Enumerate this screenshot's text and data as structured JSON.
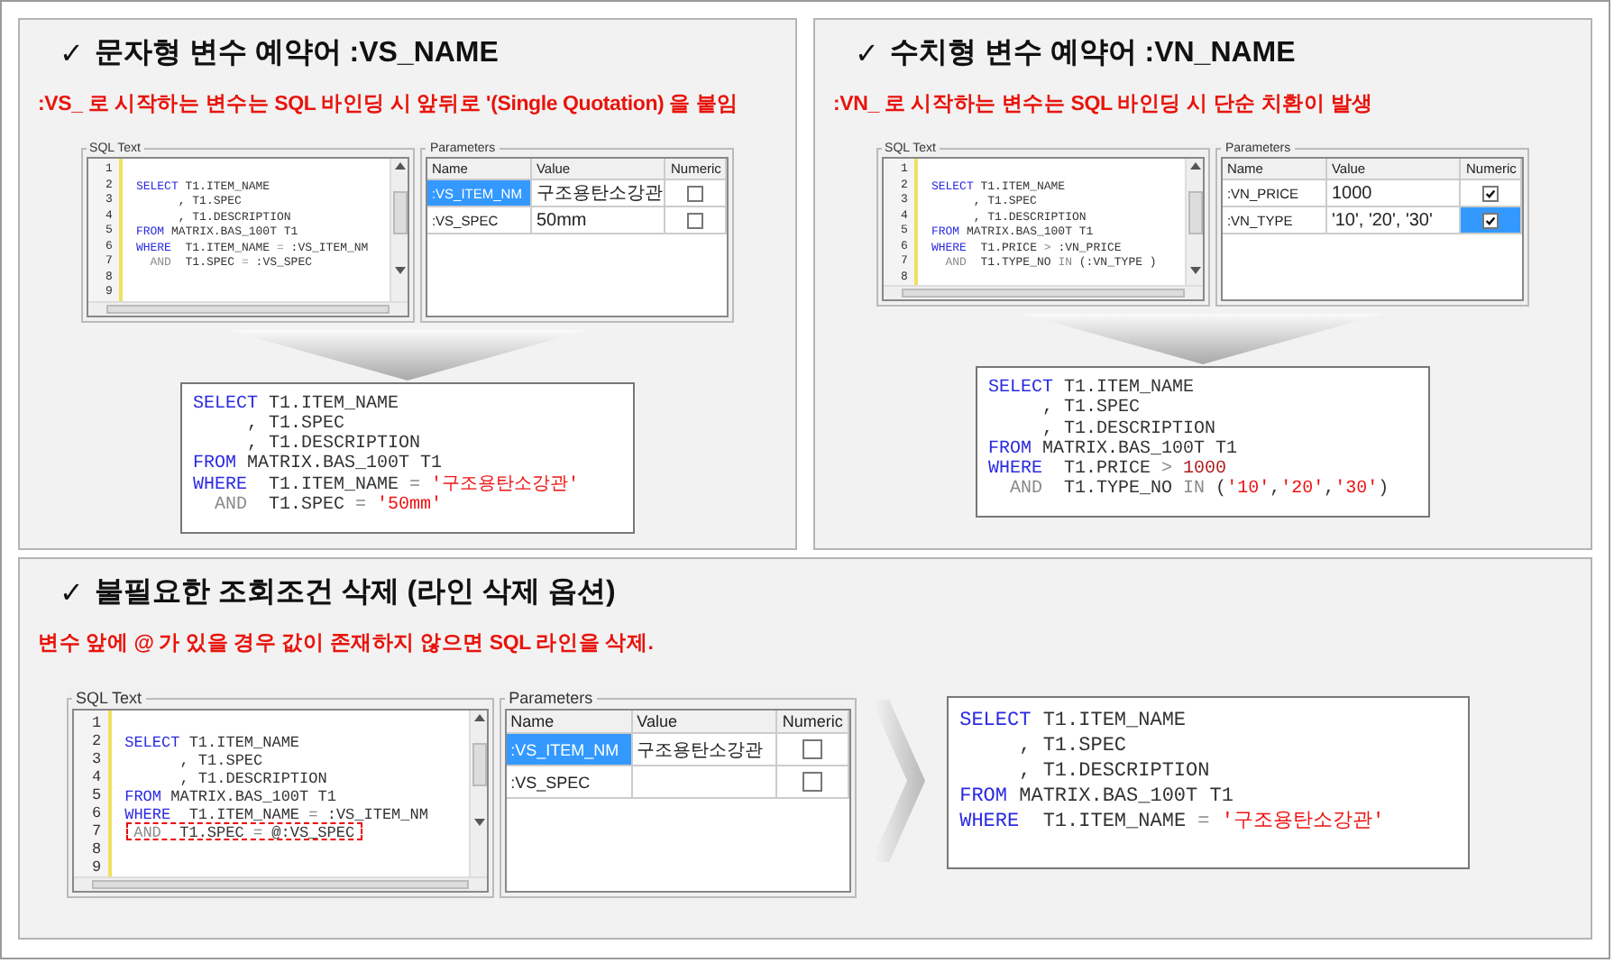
{
  "sections": [
    {
      "check": "✓",
      "title": "문자형 변수 예약어 :VS_NAME",
      "note": ":VS_ 로 시작하는 변수는 SQL 바인딩 시 앞뒤로 '(Single Quotation) 을 붙임",
      "sql_panel": {
        "label": "SQL Text",
        "lines": [
          {
            "no": "1",
            "marked": false
          },
          {
            "no": "2",
            "marked": false,
            "tokens": [
              {
                "t": "SELECT",
                "kind": "keyword"
              },
              {
                "t": " T1.ITEM_NAME",
                "kind": "plain"
              }
            ]
          },
          {
            "no": "3",
            "marked": false,
            "tokens": [
              {
                "t": "      , T1.SPEC",
                "kind": "plain"
              }
            ]
          },
          {
            "no": "4",
            "marked": false,
            "tokens": [
              {
                "t": "      , T1.DESCRIPTION",
                "kind": "plain"
              }
            ]
          },
          {
            "no": "5",
            "marked": false,
            "tokens": [
              {
                "t": "FROM",
                "kind": "keyword"
              },
              {
                "t": " MATRIX.BAS_100T T1",
                "kind": "plain"
              }
            ]
          },
          {
            "no": "6",
            "marked": false,
            "tokens": [
              {
                "t": "WHERE",
                "kind": "keyword"
              },
              {
                "t": "  T1.ITEM_NAME ",
                "kind": "plain"
              },
              {
                "t": "=",
                "kind": "operator"
              },
              {
                "t": " :VS_ITEM_NM",
                "kind": "plain"
              }
            ]
          },
          {
            "no": "7",
            "marked": false,
            "tokens": [
              {
                "t": "  AND",
                "kind": "operator"
              },
              {
                "t": "  T1.SPEC ",
                "kind": "plain"
              },
              {
                "t": "=",
                "kind": "operator"
              },
              {
                "t": " :VS_SPEC",
                "kind": "plain"
              }
            ]
          },
          {
            "no": "8",
            "marked": false
          },
          {
            "no": "9",
            "marked": false
          }
        ]
      },
      "params_panel": {
        "label": "Parameters",
        "columns": [
          "Name",
          "Value",
          "Numeric"
        ],
        "rows": [
          {
            "name": ":VS_ITEM_NM",
            "value": "구조용탄소강관",
            "numeric": false,
            "name_selected": true,
            "numeric_selected": false
          },
          {
            "name": ":VS_SPEC",
            "value": "50mm",
            "numeric": false,
            "name_selected": false,
            "numeric_selected": false
          }
        ]
      },
      "result": {
        "lines": [
          {
            "tokens": [
              {
                "t": "SELECT",
                "kind": "keyword"
              },
              {
                "t": " T1.ITEM_NAME",
                "kind": "plain"
              }
            ]
          },
          {
            "tokens": [
              {
                "t": "     , T1.SPEC",
                "kind": "plain"
              }
            ]
          },
          {
            "tokens": [
              {
                "t": "     , T1.DESCRIPTION",
                "kind": "plain"
              }
            ]
          },
          {
            "tokens": [
              {
                "t": "FROM",
                "kind": "keyword"
              },
              {
                "t": " MATRIX.BAS_100T T1",
                "kind": "plain"
              }
            ]
          },
          {
            "tokens": [
              {
                "t": "WHERE",
                "kind": "keyword"
              },
              {
                "t": "  T1.ITEM_NAME ",
                "kind": "plain"
              },
              {
                "t": "= ",
                "kind": "operator"
              },
              {
                "t": "'구조용탄소강관'",
                "kind": "string"
              }
            ]
          },
          {
            "tokens": [
              {
                "t": "  AND",
                "kind": "operator"
              },
              {
                "t": "  T1.SPEC ",
                "kind": "plain"
              },
              {
                "t": "= ",
                "kind": "operator"
              },
              {
                "t": "'50mm'",
                "kind": "string"
              }
            ]
          }
        ]
      }
    },
    {
      "check": "✓",
      "title": "수치형 변수 예약어 :VN_NAME",
      "note": ":VN_ 로 시작하는 변수는 SQL 바인딩 시 단순 치환이 발생",
      "sql_panel": {
        "label": "SQL Text",
        "lines": [
          {
            "no": "1",
            "marked": false
          },
          {
            "no": "2",
            "marked": false,
            "tokens": [
              {
                "t": "SELECT",
                "kind": "keyword"
              },
              {
                "t": " T1.ITEM_NAME",
                "kind": "plain"
              }
            ]
          },
          {
            "no": "3",
            "marked": false,
            "tokens": [
              {
                "t": "      , T1.SPEC",
                "kind": "plain"
              }
            ]
          },
          {
            "no": "4",
            "marked": false,
            "tokens": [
              {
                "t": "      , T1.DESCRIPTION",
                "kind": "plain"
              }
            ]
          },
          {
            "no": "5",
            "marked": false,
            "tokens": [
              {
                "t": "FROM",
                "kind": "keyword"
              },
              {
                "t": " MATRIX.BAS_100T T1",
                "kind": "plain"
              }
            ]
          },
          {
            "no": "6",
            "marked": false,
            "tokens": [
              {
                "t": "WHERE",
                "kind": "keyword"
              },
              {
                "t": "  T1.PRICE ",
                "kind": "plain"
              },
              {
                "t": ">",
                "kind": "operator"
              },
              {
                "t": " :VN_PRICE",
                "kind": "plain"
              }
            ]
          },
          {
            "no": "7",
            "marked": false,
            "tokens": [
              {
                "t": "  AND",
                "kind": "operator"
              },
              {
                "t": "  T1.TYPE_NO ",
                "kind": "plain"
              },
              {
                "t": "IN",
                "kind": "operator"
              },
              {
                "t": " (:VN_TYPE )",
                "kind": "plain"
              }
            ]
          },
          {
            "no": "8",
            "marked": false
          }
        ]
      },
      "params_panel": {
        "label": "Parameters",
        "columns": [
          "Name",
          "Value",
          "Numeric"
        ],
        "rows": [
          {
            "name": ":VN_PRICE",
            "value": "1000",
            "numeric": true,
            "name_selected": false,
            "numeric_selected": false
          },
          {
            "name": ":VN_TYPE",
            "value": "'10', '20', '30'",
            "numeric": true,
            "name_selected": false,
            "numeric_selected": true
          }
        ]
      },
      "result": {
        "lines": [
          {
            "tokens": [
              {
                "t": "SELECT",
                "kind": "keyword"
              },
              {
                "t": " T1.ITEM_NAME",
                "kind": "plain"
              }
            ]
          },
          {
            "tokens": [
              {
                "t": "     , T1.SPEC",
                "kind": "plain"
              }
            ]
          },
          {
            "tokens": [
              {
                "t": "     , T1.DESCRIPTION",
                "kind": "plain"
              }
            ]
          },
          {
            "tokens": [
              {
                "t": "FROM",
                "kind": "keyword"
              },
              {
                "t": " MATRIX.BAS_100T T1",
                "kind": "plain"
              }
            ]
          },
          {
            "tokens": [
              {
                "t": "WHERE",
                "kind": "keyword"
              },
              {
                "t": "  T1.PRICE ",
                "kind": "plain"
              },
              {
                "t": "> ",
                "kind": "operator"
              },
              {
                "t": "1000",
                "kind": "number"
              }
            ]
          },
          {
            "tokens": [
              {
                "t": "  AND",
                "kind": "operator"
              },
              {
                "t": "  T1.TYPE_NO ",
                "kind": "plain"
              },
              {
                "t": "IN ",
                "kind": "operator"
              },
              {
                "t": "(",
                "kind": "plain"
              },
              {
                "t": "'10'",
                "kind": "string"
              },
              {
                "t": ",",
                "kind": "plain"
              },
              {
                "t": "'20'",
                "kind": "string"
              },
              {
                "t": ",",
                "kind": "plain"
              },
              {
                "t": "'30'",
                "kind": "string"
              },
              {
                "t": ")",
                "kind": "plain"
              }
            ]
          }
        ]
      }
    },
    {
      "check": "✓",
      "title": "불필요한 조회조건 삭제 (라인 삭제 옵션)",
      "note": "변수 앞에 @ 가 있을 경우 값이 존재하지 않으면 SQL 라인을 삭제.",
      "sql_panel": {
        "label": "SQL Text",
        "lines": [
          {
            "no": "1",
            "marked": false
          },
          {
            "no": "2",
            "marked": false,
            "tokens": [
              {
                "t": "SELECT",
                "kind": "keyword"
              },
              {
                "t": " T1.ITEM_NAME",
                "kind": "plain"
              }
            ]
          },
          {
            "no": "3",
            "marked": false,
            "tokens": [
              {
                "t": "      , T1.SPEC",
                "kind": "plain"
              }
            ]
          },
          {
            "no": "4",
            "marked": false,
            "tokens": [
              {
                "t": "      , T1.DESCRIPTION",
                "kind": "plain"
              }
            ]
          },
          {
            "no": "5",
            "marked": false,
            "tokens": [
              {
                "t": "FROM",
                "kind": "keyword"
              },
              {
                "t": " MATRIX.BAS_100T T1",
                "kind": "plain"
              }
            ]
          },
          {
            "no": "6",
            "marked": false,
            "tokens": [
              {
                "t": "WHERE",
                "kind": "keyword"
              },
              {
                "t": "  T1.ITEM_NAME ",
                "kind": "plain"
              },
              {
                "t": "=",
                "kind": "operator"
              },
              {
                "t": " :VS_ITEM_NM",
                "kind": "plain"
              }
            ]
          },
          {
            "no": "7",
            "marked": true,
            "tokens": [
              {
                "t": "AND",
                "kind": "operator"
              },
              {
                "t": "  T1.SPEC ",
                "kind": "plain"
              },
              {
                "t": "=",
                "kind": "operator"
              },
              {
                "t": " @:VS_SPEC",
                "kind": "plain"
              }
            ]
          },
          {
            "no": "8",
            "marked": false
          },
          {
            "no": "9",
            "marked": false
          }
        ]
      },
      "params_panel": {
        "label": "Parameters",
        "columns": [
          "Name",
          "Value",
          "Numeric"
        ],
        "rows": [
          {
            "name": ":VS_ITEM_NM",
            "value": "구조용탄소강관",
            "numeric": false,
            "name_selected": true,
            "numeric_selected": false
          },
          {
            "name": ":VS_SPEC",
            "numeric": false,
            "name_selected": false,
            "numeric_selected": false
          }
        ]
      },
      "result": {
        "lines": [
          {
            "tokens": [
              {
                "t": "SELECT",
                "kind": "keyword"
              },
              {
                "t": " T1.ITEM_NAME",
                "kind": "plain"
              }
            ]
          },
          {
            "tokens": [
              {
                "t": "     , T1.SPEC",
                "kind": "plain"
              }
            ]
          },
          {
            "tokens": [
              {
                "t": "     , T1.DESCRIPTION",
                "kind": "plain"
              }
            ]
          },
          {
            "tokens": [
              {
                "t": "FROM",
                "kind": "keyword"
              },
              {
                "t": " MATRIX.BAS_100T T1",
                "kind": "plain"
              }
            ]
          },
          {
            "tokens": [
              {
                "t": "WHERE",
                "kind": "keyword"
              },
              {
                "t": "  T1.ITEM_NAME ",
                "kind": "plain"
              },
              {
                "t": "= ",
                "kind": "operator"
              },
              {
                "t": "'구조용탄소강관'",
                "kind": "string"
              }
            ]
          }
        ]
      }
    }
  ]
}
